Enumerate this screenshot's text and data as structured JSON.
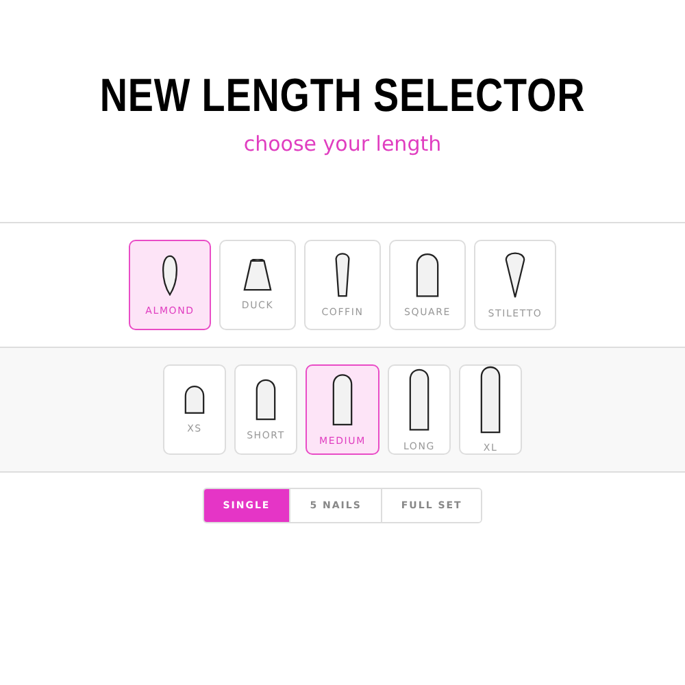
{
  "title": "NEW LENGTH SELECTOR",
  "subtitle": "choose your length",
  "shapes": [
    {
      "label": "ALMOND",
      "kind": "almond",
      "selected": true
    },
    {
      "label": "DUCK",
      "kind": "duck",
      "selected": false
    },
    {
      "label": "COFFIN",
      "kind": "coffin",
      "selected": false
    },
    {
      "label": "SQUARE",
      "kind": "square",
      "selected": false
    },
    {
      "label": "STILETTO",
      "kind": "stiletto",
      "selected": false
    }
  ],
  "lengths": [
    {
      "label": "XS",
      "kind": "xs",
      "selected": false
    },
    {
      "label": "SHORT",
      "kind": "short",
      "selected": false
    },
    {
      "label": "MEDIUM",
      "kind": "medium",
      "selected": true
    },
    {
      "label": "LONG",
      "kind": "long",
      "selected": false
    },
    {
      "label": "XL",
      "kind": "xl",
      "selected": false
    }
  ],
  "quantity": [
    {
      "label": "SINGLE",
      "selected": true
    },
    {
      "label": "5 NAILS",
      "selected": false
    },
    {
      "label": "FULL SET",
      "selected": false
    }
  ]
}
